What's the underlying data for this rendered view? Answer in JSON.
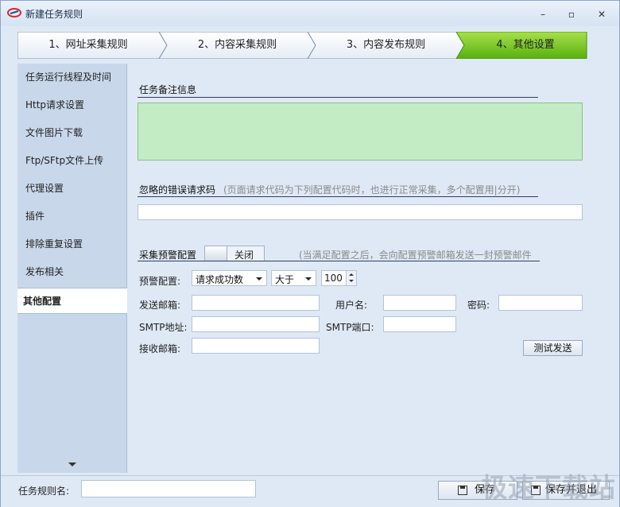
{
  "window": {
    "title": "新建任务规则",
    "controls": {
      "minimize": "–",
      "maximize": "▫",
      "close": "✕"
    }
  },
  "steps": [
    {
      "label": "1、网址采集规则",
      "active": false
    },
    {
      "label": "2、内容采集规则",
      "active": false
    },
    {
      "label": "3、内容发布规则",
      "active": false
    },
    {
      "label": "4、其他设置",
      "active": true
    }
  ],
  "nav": {
    "items": [
      {
        "label": "任务运行线程及时间"
      },
      {
        "label": "Http请求设置"
      },
      {
        "label": "文件图片下载"
      },
      {
        "label": "Ftp/SFtp文件上传"
      },
      {
        "label": "代理设置"
      },
      {
        "label": "插件"
      },
      {
        "label": "排除重复设置"
      },
      {
        "label": "发布相关"
      },
      {
        "label": "其他配置"
      }
    ],
    "active_index": 8
  },
  "content": {
    "memo": {
      "title": "任务备注信息",
      "value": ""
    },
    "ignore_errors": {
      "title": "忽略的错误请求码",
      "hint": "(页面请求代码为下列配置代码时，也进行正常采集，多个配置用|分开)",
      "value": ""
    },
    "alert": {
      "title": "采集预警配置",
      "toggle_label": "关闭",
      "hint": "(当满足配置之后，会向配置预警邮箱发送一封预警邮件",
      "config_label": "预警配置:",
      "condition_select": "请求成功数",
      "operator_select": "大于",
      "threshold": "100",
      "sender_label": "发送邮箱:",
      "sender_value": "",
      "username_label": "用户名:",
      "username_value": "",
      "password_label": "密码:",
      "password_value": "",
      "smtp_label": "SMTP地址:",
      "smtp_value": "",
      "smtp_port_label": "SMTP端口:",
      "smtp_port_value": "",
      "receiver_label": "接收邮箱:",
      "receiver_value": "",
      "test_button": "测试发送"
    }
  },
  "bottom": {
    "rule_name_label": "任务规则名:",
    "rule_name_value": "",
    "save_button": "保存",
    "save_exit_button": "保存并退出"
  },
  "watermark": "极速下载站",
  "colors": {
    "active_step": "#6cc20e",
    "memo_background": "#c3ecc5",
    "nav_background": "#c8d7ea",
    "window_background": "#dfe9f5"
  }
}
